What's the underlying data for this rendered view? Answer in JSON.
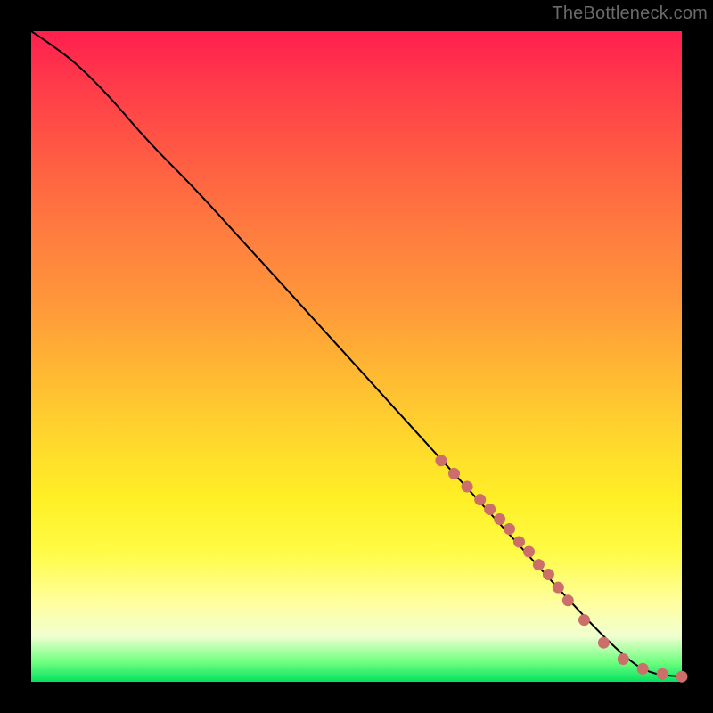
{
  "watermark": "TheBottleneck.com",
  "colors": {
    "marker": "#cc6e6a",
    "curve": "#000000",
    "frame": "#000000"
  },
  "chart_data": {
    "type": "line",
    "title": "",
    "xlabel": "",
    "ylabel": "",
    "xlim": [
      0,
      100
    ],
    "ylim": [
      0,
      100
    ],
    "x": [
      0,
      3,
      7,
      12,
      18,
      25,
      35,
      45,
      55,
      65,
      75,
      85,
      90,
      93,
      95,
      97,
      100
    ],
    "y": [
      100,
      98,
      95,
      90,
      83,
      76,
      65,
      54,
      43,
      32,
      21,
      10,
      5,
      2.5,
      1.5,
      1.0,
      0.8
    ],
    "markers": {
      "note": "Highlighted sample points drawn as salmon dots on the lower-right segment of the curve.",
      "x": [
        63,
        65,
        67,
        69,
        70.5,
        72,
        73.5,
        75,
        76.5,
        78,
        79.5,
        81,
        82.5,
        85,
        88,
        91,
        94,
        97,
        100
      ],
      "y": [
        34,
        32,
        30,
        28,
        26.5,
        25,
        23.5,
        21.5,
        20,
        18,
        16.5,
        14.5,
        12.5,
        9.5,
        6,
        3.5,
        2,
        1.2,
        0.8
      ]
    }
  }
}
